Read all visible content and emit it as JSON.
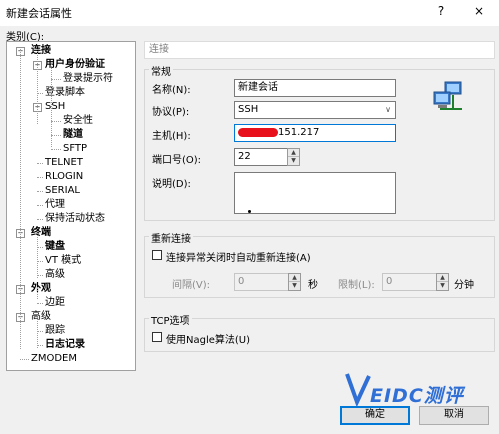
{
  "window": {
    "title": "新建会话属性",
    "help": "?",
    "close": "×"
  },
  "category_label": "类别(C):",
  "tree": [
    {
      "label": "连接",
      "bold": true,
      "toggle": "−"
    },
    {
      "label": "用户身份验证",
      "bold": true,
      "toggle": "−"
    },
    {
      "label": "登录提示符",
      "bold": false
    },
    {
      "label": "登录脚本",
      "bold": false
    },
    {
      "label": "SSH",
      "bold": false,
      "toggle": "−"
    },
    {
      "label": "安全性",
      "bold": false
    },
    {
      "label": "隧道",
      "bold": true
    },
    {
      "label": "SFTP",
      "bold": false
    },
    {
      "label": "TELNET",
      "bold": false
    },
    {
      "label": "RLOGIN",
      "bold": false
    },
    {
      "label": "SERIAL",
      "bold": false
    },
    {
      "label": "代理",
      "bold": false
    },
    {
      "label": "保持活动状态",
      "bold": false
    },
    {
      "label": "终端",
      "bold": true,
      "toggle": "−"
    },
    {
      "label": "键盘",
      "bold": true
    },
    {
      "label": "VT 模式",
      "bold": false
    },
    {
      "label": "高级",
      "bold": false
    },
    {
      "label": "外观",
      "bold": true,
      "toggle": "−"
    },
    {
      "label": "边距",
      "bold": false
    },
    {
      "label": "高级",
      "bold": false,
      "toggle": "−"
    },
    {
      "label": "跟踪",
      "bold": false
    },
    {
      "label": "日志记录",
      "bold": true
    },
    {
      "label": "ZMODEM",
      "bold": false
    }
  ],
  "section_header": "连接",
  "general": {
    "legend": "常规",
    "name_label": "名称(N):",
    "name_value": "新建会话",
    "protocol_label": "协议(P):",
    "protocol_value": "SSH",
    "host_label": "主机(H):",
    "host_value": "151.217",
    "port_label": "端口号(O):",
    "port_value": "22",
    "desc_label": "说明(D):",
    "desc_value": "",
    "network_icon": "network-computers-icon"
  },
  "reconnect": {
    "legend": "重新连接",
    "checkbox_label": "连接异常关闭时自动重新连接(A)",
    "interval_label": "间隔(V):",
    "interval_value": "0",
    "interval_unit": "秒",
    "limit_label": "限制(L):",
    "limit_value": "0",
    "limit_unit": "分钟"
  },
  "tcp": {
    "legend": "TCP选项",
    "nagle_label": "使用Nagle算法(U)"
  },
  "buttons": {
    "ok": "确定",
    "cancel": "取消"
  },
  "watermark": "EIDC测评",
  "colors": {
    "accent": "#0078d7",
    "watermark": "#2f6fd6",
    "redaction": "#e8101a"
  }
}
